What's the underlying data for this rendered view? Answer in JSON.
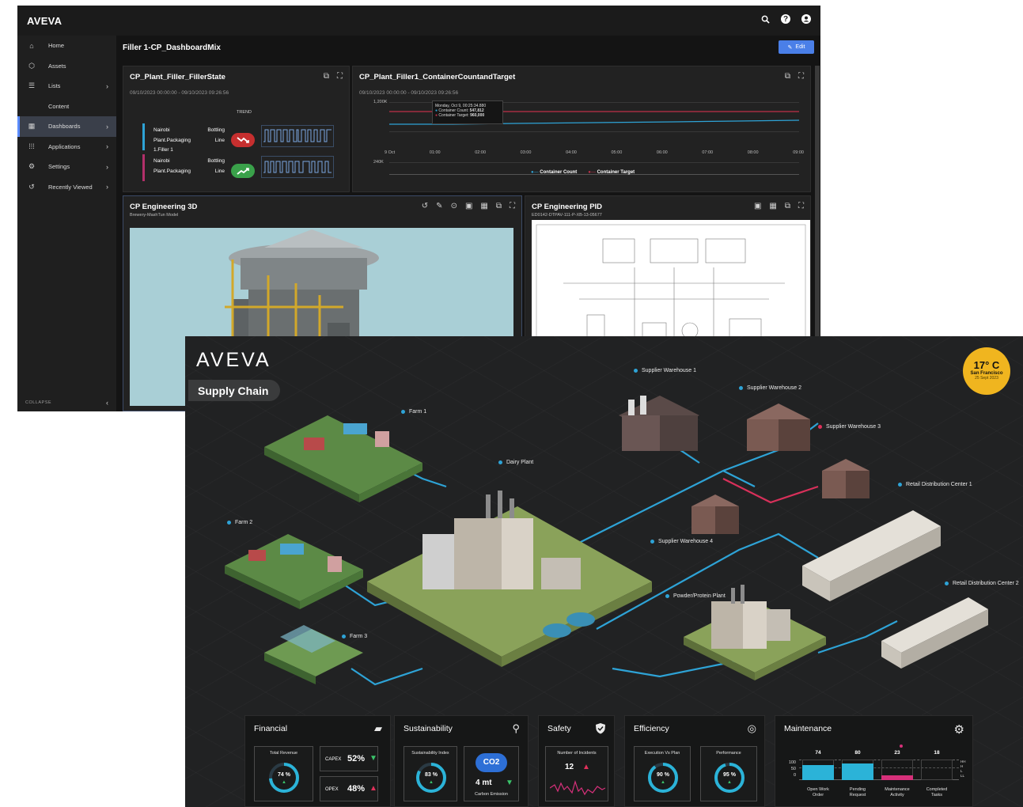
{
  "back_window": {
    "brand": "AVEVA",
    "header_icons": [
      "search-icon",
      "help-icon",
      "account-icon"
    ],
    "sidebar": {
      "items": [
        {
          "label": "Home",
          "icon": "home-icon",
          "chevron": false
        },
        {
          "label": "Assets",
          "icon": "assets-icon",
          "chevron": false
        },
        {
          "label": "Lists",
          "icon": "list-icon",
          "chevron": true
        },
        {
          "label": "Content",
          "icon": "",
          "chevron": false
        },
        {
          "label": "Dashboards",
          "icon": "dashboard-icon",
          "chevron": true,
          "active": true
        },
        {
          "label": "Applications",
          "icon": "apps-icon",
          "chevron": true
        },
        {
          "label": "Settings",
          "icon": "gear-icon",
          "chevron": true
        },
        {
          "label": "Recently Viewed",
          "icon": "history-icon",
          "chevron": true
        }
      ],
      "collapse_label": "COLLAPSE"
    },
    "page_title": "Filler 1-CP_DashboardMix",
    "edit_label": "Edit",
    "panels": {
      "filler_state": {
        "title": "CP_Plant_Filler_FillerState",
        "time_range": "09/10/2023 00:00:00 - 09/10/2023 09:26:56",
        "trend_header": "TREND",
        "rows": [
          {
            "location_1": "Nairobi",
            "location_2": "Plant.Packaging",
            "location_3": "1.Filler 1",
            "line_1": "Bottling",
            "line_2": "Line",
            "trend": "down",
            "color": "#2ea3d6"
          },
          {
            "location_1": "Nairobi",
            "location_2": "Plant.Packaging",
            "location_3": "",
            "line_1": "Bottling",
            "line_2": "Line",
            "trend": "up",
            "color": "#b3306a"
          }
        ]
      },
      "container_count": {
        "title": "CP_Plant_Filler1_ContainerCountandTarget",
        "time_range": "09/10/2023 00:00:00 - 09/10/2023 09:26:56",
        "y_ticks": [
          "1,200K",
          "240K"
        ],
        "x_ticks": [
          "9 Oct",
          "01:00",
          "02:00",
          "03:00",
          "04:00",
          "05:00",
          "06:00",
          "07:00",
          "08:00",
          "09:00"
        ],
        "tooltip": {
          "date": "Monday, Oct 9, 00:25:34.880",
          "count_label": "Container Count:",
          "count_value": "547,812",
          "target_label": "Container Target:",
          "target_value": "960,000"
        },
        "legend": [
          "Container Count",
          "Container Target"
        ],
        "colors": {
          "count": "#2ea3d6",
          "target": "#c0304a"
        }
      },
      "engineering_3d": {
        "title": "CP Engineering 3D",
        "subtitle": "Brewery-MashTun Model"
      },
      "engineering_pid": {
        "title": "CP Engineering PID",
        "subtitle": "ED0142-DTPAV-111-P-XB-13-05677"
      }
    }
  },
  "front_window": {
    "logo": "AVEVA",
    "section_title": "Supply Chain",
    "weather": {
      "temp": "17° C",
      "city": "San Francisco",
      "date": "25 Sept 2023"
    },
    "map_labels": [
      {
        "key": "farm1",
        "text": "Farm 1",
        "status": "ok"
      },
      {
        "key": "farm2",
        "text": "Farm 2",
        "status": "ok"
      },
      {
        "key": "farm3",
        "text": "Farm 3",
        "status": "ok"
      },
      {
        "key": "dairy",
        "text": "Dairy Plant",
        "status": "ok"
      },
      {
        "key": "sw1",
        "text": "Supplier Warehouse 1",
        "status": "ok"
      },
      {
        "key": "sw2",
        "text": "Supplier Warehouse 2",
        "status": "ok"
      },
      {
        "key": "sw3",
        "text": "Supplier Warehouse 3",
        "status": "alert"
      },
      {
        "key": "sw4",
        "text": "Supplier Warehouse 4",
        "status": "ok"
      },
      {
        "key": "rdc1",
        "text": "Retail Distribution Center 1",
        "status": "ok"
      },
      {
        "key": "rdc2",
        "text": "Retail Distribution Center 2",
        "status": "ok"
      },
      {
        "key": "powder",
        "text": "Powder/Protein Plant",
        "status": "ok"
      }
    ],
    "kpis": {
      "financial": {
        "title": "Financial",
        "icon": "money-icon",
        "total_revenue_label": "Total Revenue",
        "total_revenue_value": "74 %",
        "total_revenue_pct": 0.74,
        "capex_label": "CAPEX",
        "capex_value": "52%",
        "capex_trend": "down",
        "opex_label": "OPEX",
        "opex_value": "48%",
        "opex_trend": "up"
      },
      "sustainability": {
        "title": "Sustainability",
        "icon": "leaf-icon",
        "index_label": "Sustainability Index",
        "index_value": "83 %",
        "index_pct": 0.83,
        "co2_badge": "CO2",
        "co2_value": "4 mt",
        "co2_label": "Carbon Emission"
      },
      "safety": {
        "title": "Safety",
        "icon": "shield-icon",
        "incidents_label": "Number of Incidents",
        "incidents_value": "12"
      },
      "efficiency": {
        "title": "Efficiency",
        "icon": "target-icon",
        "exec_label": "Execution Vs Plan",
        "exec_value": "90 %",
        "exec_pct": 0.9,
        "perf_label": "Performance",
        "perf_value": "95 %",
        "perf_pct": 0.95
      },
      "maintenance": {
        "title": "Maintenance",
        "icon": "gear-icon",
        "axis": [
          "100",
          "50",
          "0"
        ],
        "right_axis": [
          "HH",
          "H",
          "L",
          "LL"
        ],
        "bars": [
          {
            "value": "74",
            "label_1": "Open Work",
            "label_2": "Order",
            "fill": 0.74,
            "color": "#2bb3d8"
          },
          {
            "value": "80",
            "label_1": "Pending",
            "label_2": "Request",
            "fill": 0.8,
            "color": "#2bb3d8"
          },
          {
            "value": "23",
            "label_1": "Maintenance",
            "label_2": "Activity",
            "fill": 0.23,
            "color": "#d6307a"
          },
          {
            "value": "18",
            "label_1": "Completed",
            "label_2": "Tasks",
            "fill": 0.0,
            "color": "#2bb3d8"
          }
        ]
      }
    }
  }
}
